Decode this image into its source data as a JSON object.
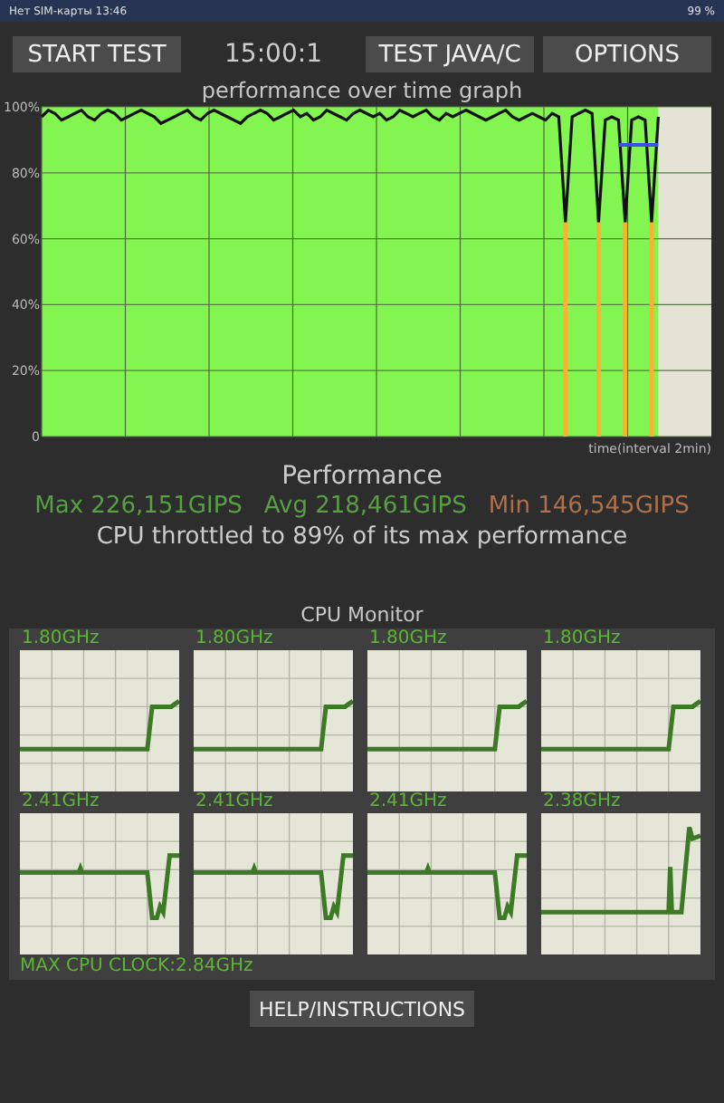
{
  "status_bar": {
    "left": "Нет SIM-карты 13:46",
    "battery": "99 %"
  },
  "toolbar": {
    "start_button": "START TEST",
    "timer": "15:00:1",
    "java_button": "TEST JAVA/C",
    "options_button": "OPTIONS"
  },
  "graph": {
    "chart_data": {
      "type": "line",
      "title": "performance over time graph",
      "xlabel": "time(interval 2min)",
      "ylim": [
        0,
        100
      ],
      "grid": true,
      "yticks": [
        {
          "value": 0,
          "label": "0"
        },
        {
          "value": 20,
          "label": "20%"
        },
        {
          "value": 40,
          "label": "40%"
        },
        {
          "value": 60,
          "label": "60%"
        },
        {
          "value": 80,
          "label": "80%"
        },
        {
          "value": 100,
          "label": "100%"
        }
      ],
      "values": [
        97,
        99,
        98,
        96,
        97,
        98,
        99,
        97,
        96,
        98,
        99,
        98,
        96,
        97,
        98,
        99,
        98,
        97,
        95,
        96,
        97,
        98,
        99,
        97,
        96,
        98,
        99,
        98,
        97,
        96,
        95,
        97,
        98,
        99,
        98,
        96,
        97,
        98,
        99,
        97,
        98,
        96,
        97,
        99,
        98,
        97,
        96,
        98,
        99,
        98,
        97,
        98,
        96,
        97,
        99,
        98,
        97,
        98,
        99,
        97,
        96,
        98,
        97,
        98,
        99,
        98,
        97,
        96,
        97,
        98,
        99,
        97,
        96,
        97,
        98,
        97,
        96,
        98,
        97,
        65,
        97,
        98,
        99,
        98,
        65,
        96,
        97,
        96,
        65,
        96,
        97,
        96,
        65,
        97
      ]
    }
  },
  "performance": {
    "title": "Performance",
    "max": "Max 226,151GIPS",
    "avg": "Avg 218,461GIPS",
    "min": "Min 146,545GIPS",
    "throttle": "CPU throttled to 89% of its max performance"
  },
  "cpu_monitor": {
    "title": "CPU Monitor",
    "cores": [
      {
        "freq": "1.80GHz",
        "kind": "step-up"
      },
      {
        "freq": "1.80GHz",
        "kind": "step-up"
      },
      {
        "freq": "1.80GHz",
        "kind": "step-up"
      },
      {
        "freq": "1.80GHz",
        "kind": "step-up"
      },
      {
        "freq": "2.41GHz",
        "kind": "dip"
      },
      {
        "freq": "2.41GHz",
        "kind": "dip"
      },
      {
        "freq": "2.41GHz",
        "kind": "dip"
      },
      {
        "freq": "2.38GHz",
        "kind": "spike"
      }
    ],
    "max_clock": "MAX CPU CLOCK:2.84GHz"
  },
  "help_button": "HELP/INSTRUCTIONS"
}
